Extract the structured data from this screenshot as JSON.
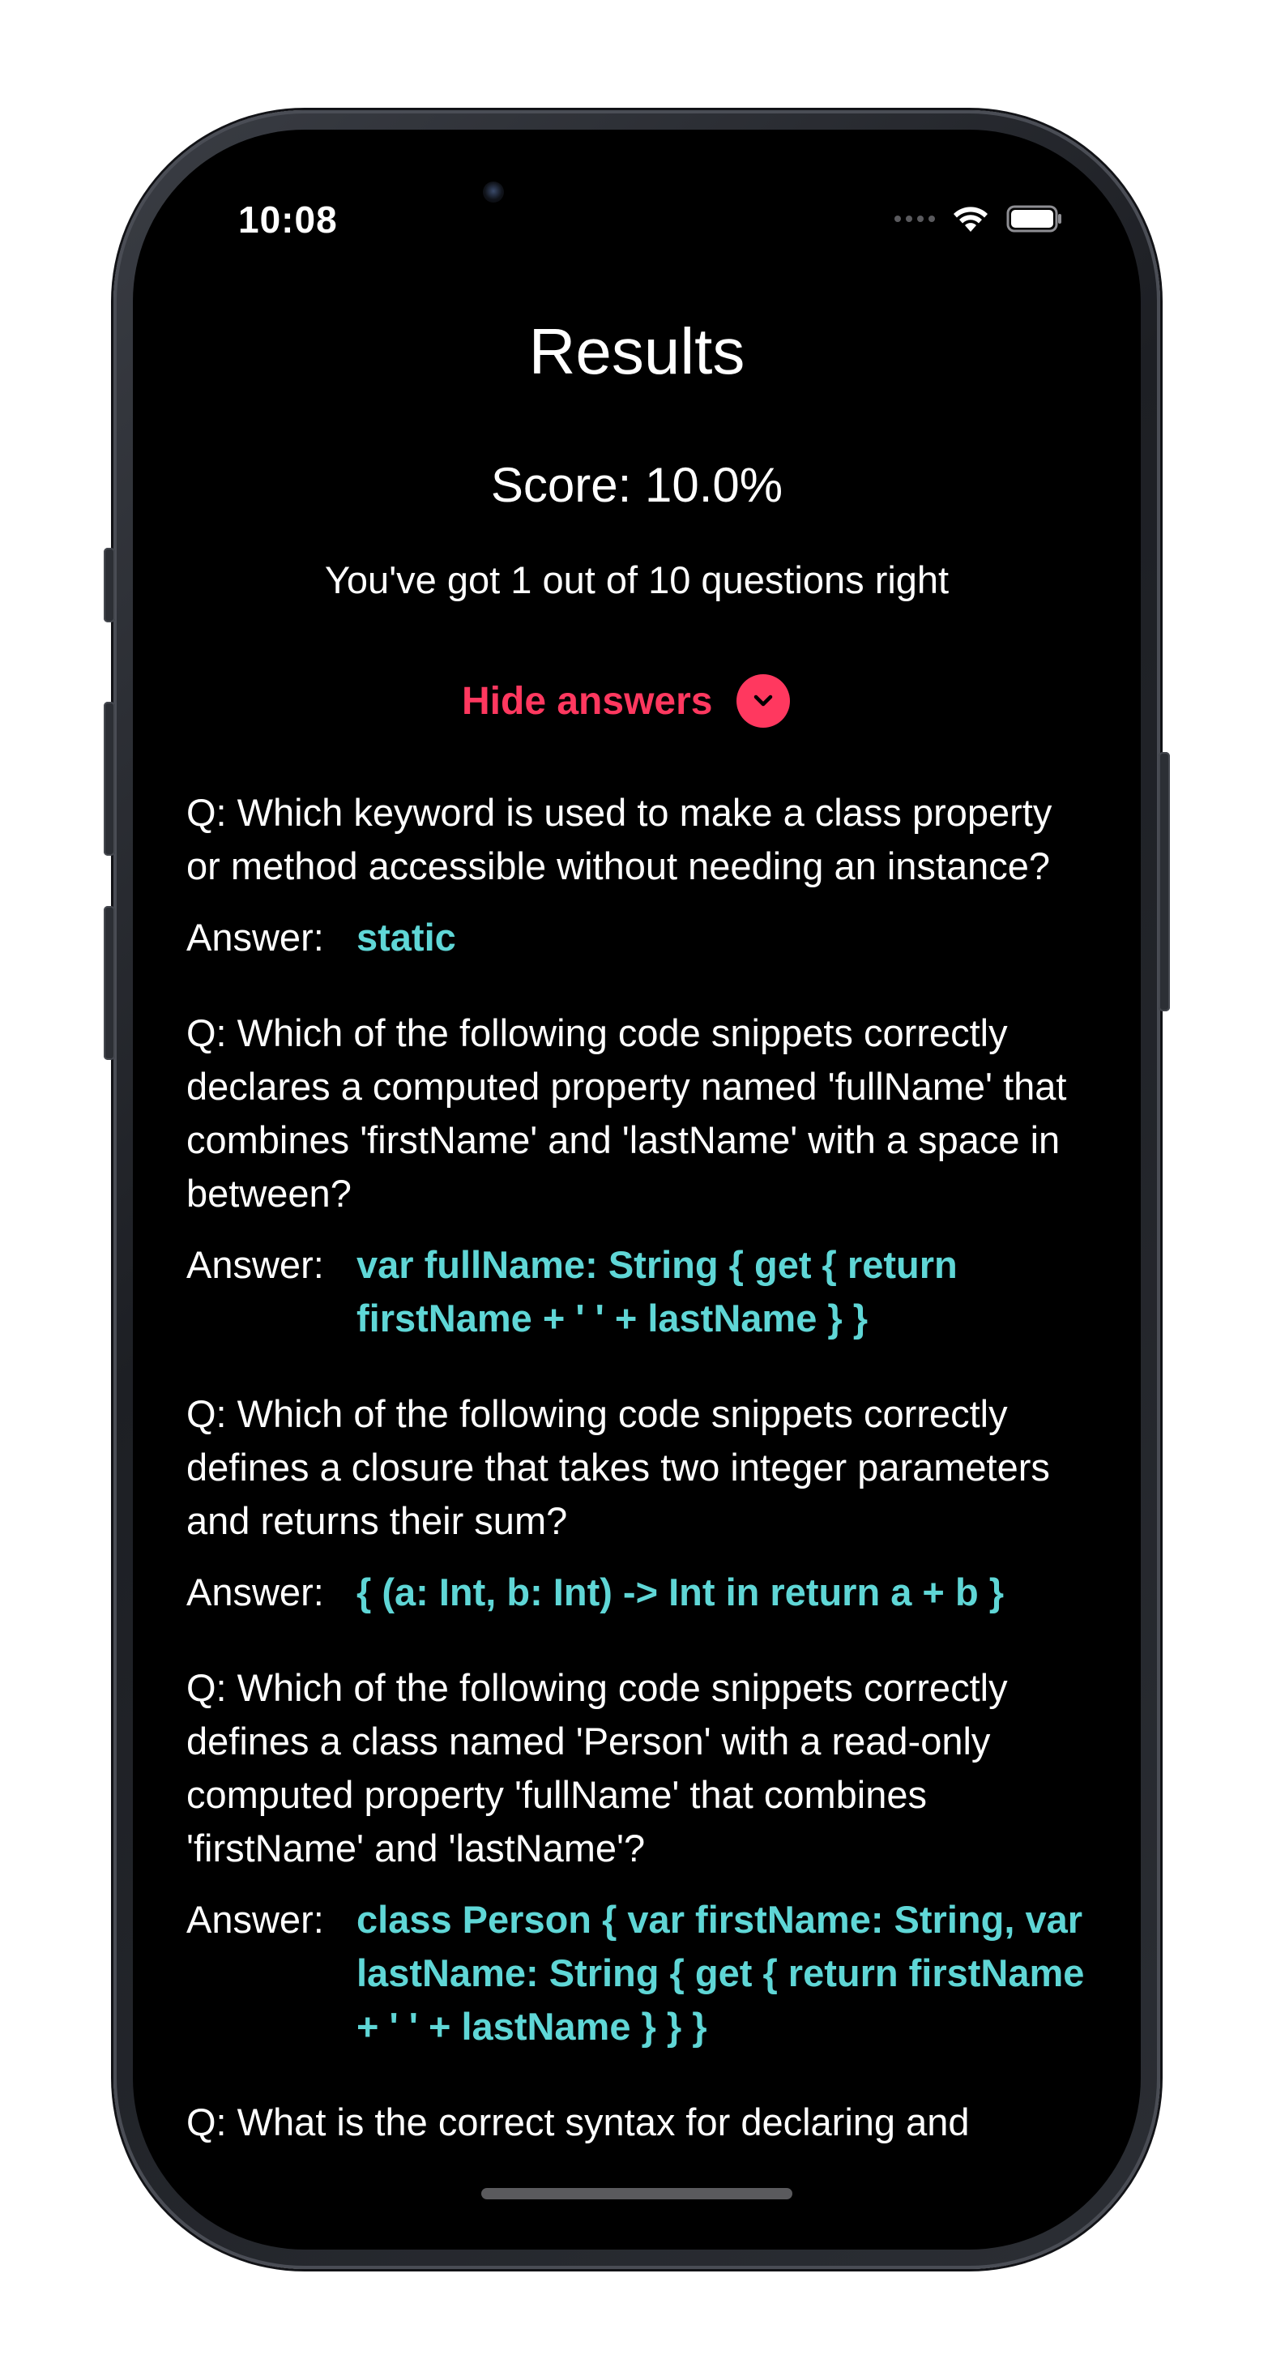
{
  "status_bar": {
    "time": "10:08"
  },
  "header": {
    "title": "Results",
    "score": "Score: 10.0%",
    "summary": "You've got 1 out of 10 questions right"
  },
  "toggle": {
    "label": "Hide answers",
    "icon": "chevron-down-icon",
    "color": "#ff385f"
  },
  "answer_label": "Answer:",
  "answer_color": "#5fd6d6",
  "results": [
    {
      "question": "Q: Which keyword is used to make a class property or method accessible without needing an instance?",
      "answer": "static"
    },
    {
      "question": "Q: Which of the following code snippets correctly declares a computed property named 'fullName' that combines 'firstName' and 'lastName' with a space in between?",
      "answer": "var fullName: String { get { return firstName + ' ' + lastName } }"
    },
    {
      "question": "Q: Which of the following code snippets correctly defines a closure that takes two integer parameters and returns their sum?",
      "answer": "{ (a: Int, b: Int) -> Int in return a + b }"
    },
    {
      "question": "Q: Which of the following code snippets correctly defines a class named 'Person' with a read-only computed property 'fullName' that combines 'firstName' and 'lastName'?",
      "answer": "class Person { var firstName: String, var lastName: String { get { return firstName + ' ' + lastName } } }"
    },
    {
      "question": "Q: What is the correct syntax for declaring and"
    }
  ]
}
